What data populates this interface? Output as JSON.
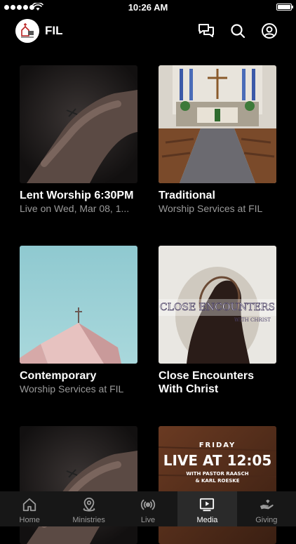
{
  "status": {
    "time": "10:26 AM"
  },
  "header": {
    "title": "FIL",
    "logo_icon": "church-logo",
    "icons": [
      "chat-icon",
      "search-icon",
      "account-icon"
    ]
  },
  "media": {
    "items": [
      {
        "title": "Lent Worship 6:30PM",
        "subtitle": "Live on Wed, Mar 08, 1..."
      },
      {
        "title": "Traditional",
        "subtitle": "Worship Services at FIL"
      },
      {
        "title": "Contemporary",
        "subtitle": "Worship Services at FIL"
      },
      {
        "title": "Close Encounters With Christ",
        "subtitle": "",
        "art_title": "CLOSE ENCOUNTERS",
        "art_sub": "WITH CHRIST"
      },
      {
        "title": "",
        "subtitle": ""
      },
      {
        "title": "",
        "subtitle": "",
        "art_day": "FRIDAY",
        "art_main": "LIVE AT 12:05",
        "art_line1": "WITH PASTOR RAASCH",
        "art_line2": "& KARL ROESKE"
      }
    ]
  },
  "tabbar": {
    "active": "Media",
    "tabs": [
      {
        "label": "Home",
        "icon": "home-icon"
      },
      {
        "label": "Ministries",
        "icon": "location-pin-icon"
      },
      {
        "label": "Live",
        "icon": "broadcast-icon"
      },
      {
        "label": "Media",
        "icon": "play-icon"
      },
      {
        "label": "Giving",
        "icon": "giving-hand-icon"
      }
    ]
  }
}
